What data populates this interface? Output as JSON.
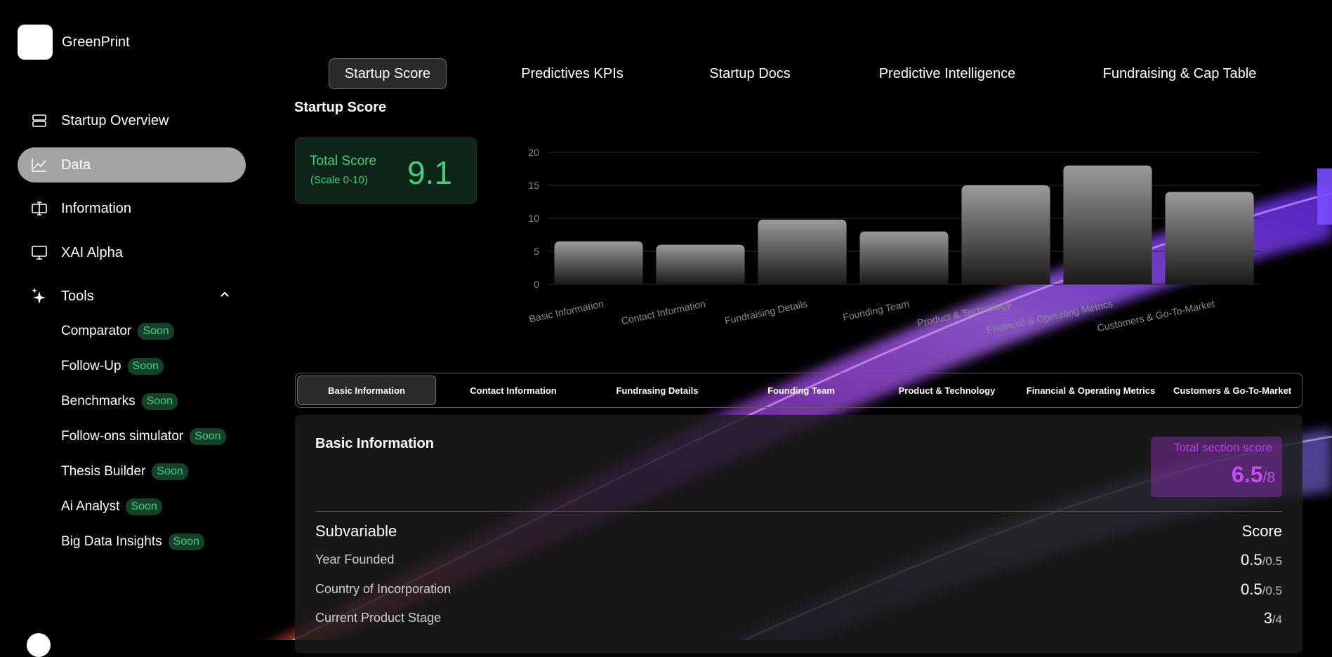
{
  "brand": {
    "name": "GreenPrint"
  },
  "sidebar": {
    "nav": [
      {
        "label": "Startup Overview",
        "icon": "layers-icon",
        "active": false
      },
      {
        "label": "Data",
        "icon": "chart-line-icon",
        "active": true
      },
      {
        "label": "Information",
        "icon": "text-cursor-icon",
        "active": false
      },
      {
        "label": "XAI Alpha",
        "icon": "monitor-icon",
        "active": false
      },
      {
        "label": "Tools",
        "icon": "sparkles-icon",
        "active": false,
        "expanded": true
      }
    ],
    "tools": [
      {
        "label": "Comparator",
        "badge": "Soon"
      },
      {
        "label": "Follow-Up",
        "badge": "Soon"
      },
      {
        "label": "Benchmarks",
        "badge": "Soon"
      },
      {
        "label": "Follow-ons simulator",
        "badge": "Soon"
      },
      {
        "label": "Thesis Builder",
        "badge": "Soon"
      },
      {
        "label": "Ai Analyst",
        "badge": "Soon"
      },
      {
        "label": "Big Data Insights",
        "badge": "Soon"
      }
    ]
  },
  "top_tabs": [
    "Startup Score",
    "Predictives KPIs",
    "Startup Docs",
    "Predictive Intelligence",
    "Fundraising & Cap Table"
  ],
  "active_top_tab": "Startup Score",
  "section_title": "Startup Score",
  "score_card": {
    "title": "Total Score",
    "scale": "(Scale 0-10)",
    "value": "9.1"
  },
  "chart_data": {
    "type": "bar",
    "categories": [
      "Basic Information",
      "Contact Information",
      "Fundraising Details",
      "Founding Team",
      "Product & Technology",
      "Financial & Operating Metrics",
      "Customers & Go-To-Market"
    ],
    "values": [
      6.5,
      6,
      9.8,
      8,
      15,
      18,
      14
    ],
    "yticks": [
      "0",
      "5",
      "10",
      "15",
      "20"
    ],
    "ylim": [
      0,
      20
    ],
    "grid": true
  },
  "section_tabs": [
    "Basic Information",
    "Contact Information",
    "Fundrasing Details",
    "Founding Team",
    "Product & Technology",
    "Financial & Operating Metrics",
    "Customers & Go-To-Market"
  ],
  "active_section_tab": "Basic Information",
  "detail": {
    "title": "Basic Information",
    "section_score_label": "Total section score",
    "section_score_value": "6.5",
    "section_score_max": "/8",
    "header_subvariable": "Subvariable",
    "header_score": "Score",
    "rows": [
      {
        "name": "Year Founded",
        "score": "0.5",
        "max": "/0.5"
      },
      {
        "name": "Country of Incorporation",
        "score": "0.5",
        "max": "/0.5"
      },
      {
        "name": "Current Product Stage",
        "score": "3",
        "max": "/4"
      }
    ]
  },
  "colors": {
    "accent_green": "#3fd07e",
    "accent_purple": "#c64bf0",
    "active_nav": "#a3a3a3"
  }
}
